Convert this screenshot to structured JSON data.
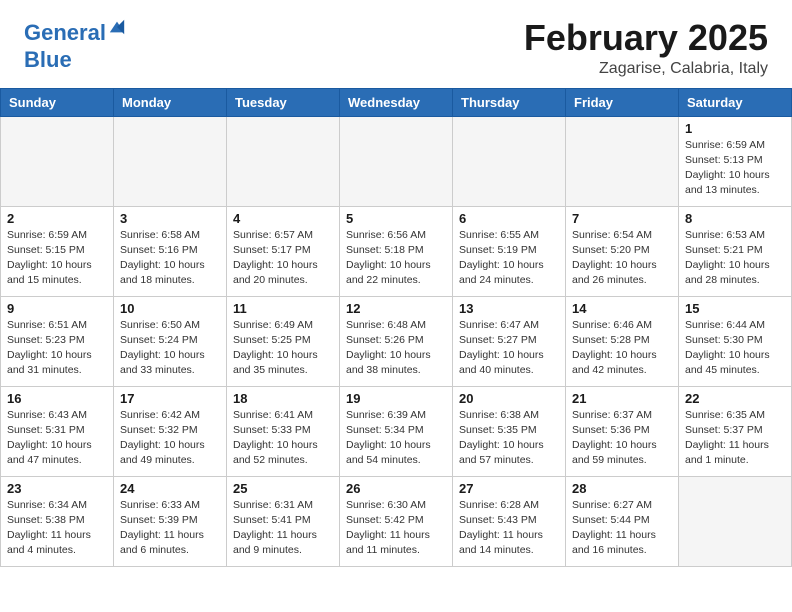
{
  "header": {
    "logo_line1": "General",
    "logo_line2": "Blue",
    "month": "February 2025",
    "location": "Zagarise, Calabria, Italy"
  },
  "days_of_week": [
    "Sunday",
    "Monday",
    "Tuesday",
    "Wednesday",
    "Thursday",
    "Friday",
    "Saturday"
  ],
  "weeks": [
    [
      {
        "day": "",
        "info": ""
      },
      {
        "day": "",
        "info": ""
      },
      {
        "day": "",
        "info": ""
      },
      {
        "day": "",
        "info": ""
      },
      {
        "day": "",
        "info": ""
      },
      {
        "day": "",
        "info": ""
      },
      {
        "day": "1",
        "info": "Sunrise: 6:59 AM\nSunset: 5:13 PM\nDaylight: 10 hours\nand 13 minutes."
      }
    ],
    [
      {
        "day": "2",
        "info": "Sunrise: 6:59 AM\nSunset: 5:15 PM\nDaylight: 10 hours\nand 15 minutes."
      },
      {
        "day": "3",
        "info": "Sunrise: 6:58 AM\nSunset: 5:16 PM\nDaylight: 10 hours\nand 18 minutes."
      },
      {
        "day": "4",
        "info": "Sunrise: 6:57 AM\nSunset: 5:17 PM\nDaylight: 10 hours\nand 20 minutes."
      },
      {
        "day": "5",
        "info": "Sunrise: 6:56 AM\nSunset: 5:18 PM\nDaylight: 10 hours\nand 22 minutes."
      },
      {
        "day": "6",
        "info": "Sunrise: 6:55 AM\nSunset: 5:19 PM\nDaylight: 10 hours\nand 24 minutes."
      },
      {
        "day": "7",
        "info": "Sunrise: 6:54 AM\nSunset: 5:20 PM\nDaylight: 10 hours\nand 26 minutes."
      },
      {
        "day": "8",
        "info": "Sunrise: 6:53 AM\nSunset: 5:21 PM\nDaylight: 10 hours\nand 28 minutes."
      }
    ],
    [
      {
        "day": "9",
        "info": "Sunrise: 6:51 AM\nSunset: 5:23 PM\nDaylight: 10 hours\nand 31 minutes."
      },
      {
        "day": "10",
        "info": "Sunrise: 6:50 AM\nSunset: 5:24 PM\nDaylight: 10 hours\nand 33 minutes."
      },
      {
        "day": "11",
        "info": "Sunrise: 6:49 AM\nSunset: 5:25 PM\nDaylight: 10 hours\nand 35 minutes."
      },
      {
        "day": "12",
        "info": "Sunrise: 6:48 AM\nSunset: 5:26 PM\nDaylight: 10 hours\nand 38 minutes."
      },
      {
        "day": "13",
        "info": "Sunrise: 6:47 AM\nSunset: 5:27 PM\nDaylight: 10 hours\nand 40 minutes."
      },
      {
        "day": "14",
        "info": "Sunrise: 6:46 AM\nSunset: 5:28 PM\nDaylight: 10 hours\nand 42 minutes."
      },
      {
        "day": "15",
        "info": "Sunrise: 6:44 AM\nSunset: 5:30 PM\nDaylight: 10 hours\nand 45 minutes."
      }
    ],
    [
      {
        "day": "16",
        "info": "Sunrise: 6:43 AM\nSunset: 5:31 PM\nDaylight: 10 hours\nand 47 minutes."
      },
      {
        "day": "17",
        "info": "Sunrise: 6:42 AM\nSunset: 5:32 PM\nDaylight: 10 hours\nand 49 minutes."
      },
      {
        "day": "18",
        "info": "Sunrise: 6:41 AM\nSunset: 5:33 PM\nDaylight: 10 hours\nand 52 minutes."
      },
      {
        "day": "19",
        "info": "Sunrise: 6:39 AM\nSunset: 5:34 PM\nDaylight: 10 hours\nand 54 minutes."
      },
      {
        "day": "20",
        "info": "Sunrise: 6:38 AM\nSunset: 5:35 PM\nDaylight: 10 hours\nand 57 minutes."
      },
      {
        "day": "21",
        "info": "Sunrise: 6:37 AM\nSunset: 5:36 PM\nDaylight: 10 hours\nand 59 minutes."
      },
      {
        "day": "22",
        "info": "Sunrise: 6:35 AM\nSunset: 5:37 PM\nDaylight: 11 hours\nand 1 minute."
      }
    ],
    [
      {
        "day": "23",
        "info": "Sunrise: 6:34 AM\nSunset: 5:38 PM\nDaylight: 11 hours\nand 4 minutes."
      },
      {
        "day": "24",
        "info": "Sunrise: 6:33 AM\nSunset: 5:39 PM\nDaylight: 11 hours\nand 6 minutes."
      },
      {
        "day": "25",
        "info": "Sunrise: 6:31 AM\nSunset: 5:41 PM\nDaylight: 11 hours\nand 9 minutes."
      },
      {
        "day": "26",
        "info": "Sunrise: 6:30 AM\nSunset: 5:42 PM\nDaylight: 11 hours\nand 11 minutes."
      },
      {
        "day": "27",
        "info": "Sunrise: 6:28 AM\nSunset: 5:43 PM\nDaylight: 11 hours\nand 14 minutes."
      },
      {
        "day": "28",
        "info": "Sunrise: 6:27 AM\nSunset: 5:44 PM\nDaylight: 11 hours\nand 16 minutes."
      },
      {
        "day": "",
        "info": ""
      }
    ]
  ]
}
